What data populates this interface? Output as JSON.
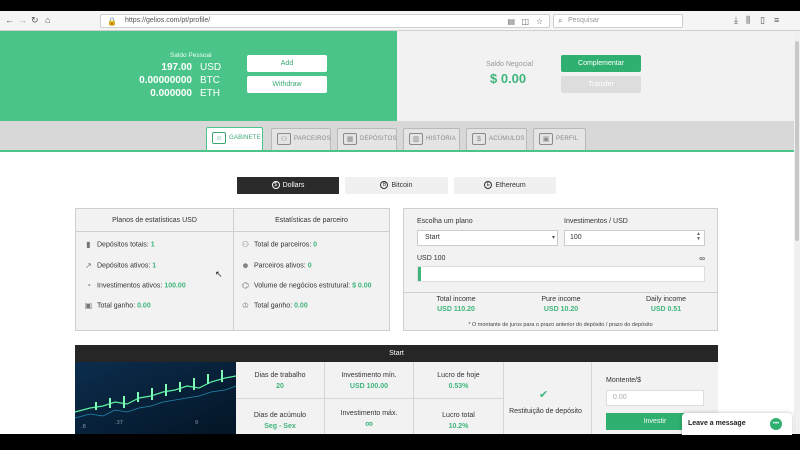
{
  "browser": {
    "url": "https://gelios.com/pt/profile/",
    "search_placeholder": "Pesquisar"
  },
  "balance": {
    "label": "Saldo Pessoal",
    "rows": [
      {
        "amount": "197.00",
        "currency": "USD"
      },
      {
        "amount": "0.00000000",
        "currency": "BTC"
      },
      {
        "amount": "0.000000",
        "currency": "ETH"
      }
    ],
    "add_label": "Add",
    "withdraw_label": "Withdraw"
  },
  "negocial": {
    "label": "Saldo Negocial",
    "value": "$ 0.00",
    "complement_label": "Complementar",
    "transfer_label": "Transfer"
  },
  "tabs": [
    {
      "label": "GABINETE",
      "icon": "person-icon",
      "active": true
    },
    {
      "label": "PARCEIROS",
      "icon": "partners-icon",
      "active": false
    },
    {
      "label": "DEPÓSITOS",
      "icon": "deposit-icon",
      "active": false
    },
    {
      "label": "HISTÓRIA",
      "icon": "history-icon",
      "active": false
    },
    {
      "label": "ACÚMULOS",
      "icon": "coins-icon",
      "active": false
    },
    {
      "label": "PERFIL",
      "icon": "profile-icon",
      "active": false
    }
  ],
  "currency_switch": [
    {
      "label": "Dollars",
      "symbol": "$",
      "active": true
    },
    {
      "label": "Bitcoin",
      "symbol": "B",
      "active": false
    },
    {
      "label": "Ethereum",
      "symbol": "E",
      "active": false
    }
  ],
  "stats": {
    "left_title": "Planos de estatísticas USD",
    "right_title": "Estatísticas de parceiro",
    "left_rows": [
      {
        "label": "Depósitos totais: ",
        "value": "1"
      },
      {
        "label": "Depósitos ativos: ",
        "value": "1"
      },
      {
        "label": "Investimentos ativos: ",
        "value": "100.00"
      },
      {
        "label": "Total ganho: ",
        "value": "0.00"
      }
    ],
    "right_rows": [
      {
        "label": "Total de parceiros: ",
        "value": "0"
      },
      {
        "label": "Parceiros ativos: ",
        "value": "0"
      },
      {
        "label": "Volume de negócios estrutural: ",
        "value": "$ 0.00"
      },
      {
        "label": "Total ganho: ",
        "value": "0.00"
      }
    ]
  },
  "calculator": {
    "plan_label": "Escolha um plano",
    "plan_value": "Start",
    "invest_label": "Investimentos / USD",
    "invest_value": "100",
    "amount_label": "USD 100",
    "infinity": "∞",
    "slider_fraction": 0.01,
    "incomes": [
      {
        "title": "Total income",
        "value": "USD 110.20"
      },
      {
        "title": "Pure income",
        "value": "USD 10.20"
      },
      {
        "title": "Daily income",
        "value": "USD 0.51"
      }
    ],
    "note": "* O montante de juros para o prazo anterior do depósito / prazo do depósito"
  },
  "plan": {
    "title": "Start",
    "cells": [
      {
        "title": "Dias de trabalho",
        "value": "20"
      },
      {
        "title": "Investimento mín.",
        "value": "USD 100.00"
      },
      {
        "title": "Lucro de hoje",
        "value": "0.53%"
      },
      {
        "title": "Dias de acúmulo",
        "value": "Seg - Sex"
      },
      {
        "title": "Investimento máx.",
        "value": "∞"
      },
      {
        "title": "Lucro total",
        "value": "10.2%"
      }
    ],
    "return_label": "Restituição de depósito",
    "amount_label": "Montente/$",
    "amount_placeholder": "0.00",
    "invest_label": "Investir"
  },
  "chat": {
    "label": "Leave a message"
  },
  "colors": {
    "accent": "#4bc48a",
    "accent_dark": "#2fb070",
    "value_green": "#3fb57b",
    "dark_header": "#262626"
  }
}
